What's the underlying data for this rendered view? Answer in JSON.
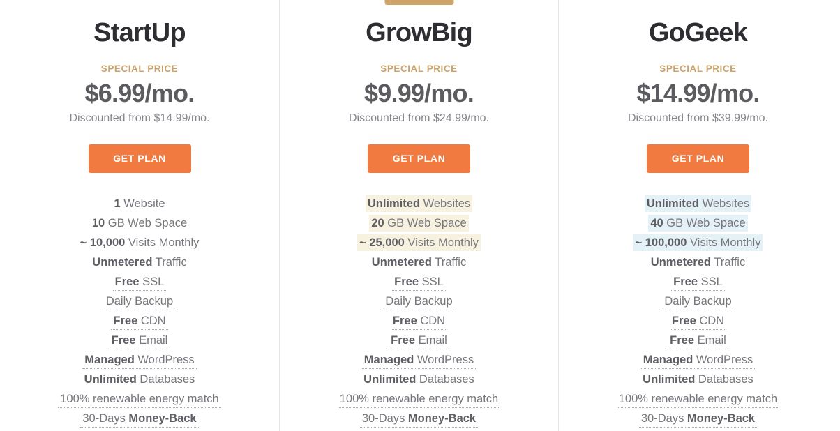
{
  "plans": [
    {
      "id": "startup",
      "name": "StartUp",
      "special_price_label": "SPECIAL PRICE",
      "price": "$6.99/mo.",
      "discount_note": "Discounted from $14.99/mo.",
      "cta_label": "GET PLAN",
      "recommended": false,
      "recommended_label": "",
      "highlight_color": "",
      "features": [
        {
          "strong": "1",
          "rest": " Website",
          "tip": false,
          "highlight": false
        },
        {
          "strong": "10",
          "rest": " GB Web Space",
          "tip": false,
          "highlight": false
        },
        {
          "strong": "~ 10,000",
          "rest": " Visits Monthly",
          "tip": false,
          "highlight": false
        },
        {
          "strong": "Unmetered",
          "rest": " Traffic",
          "tip": false,
          "highlight": false
        },
        {
          "strong": "Free",
          "rest": " SSL",
          "tip": true,
          "highlight": false
        },
        {
          "strong": "",
          "rest": "Daily Backup",
          "tip": true,
          "highlight": false
        },
        {
          "strong": "Free",
          "rest": " CDN",
          "tip": true,
          "highlight": false
        },
        {
          "strong": "Free",
          "rest": " Email",
          "tip": true,
          "highlight": false
        },
        {
          "strong": "Managed",
          "rest": " WordPress",
          "tip": true,
          "highlight": false
        },
        {
          "strong": "Unlimited",
          "rest": " Databases",
          "tip": false,
          "highlight": false
        },
        {
          "strong": "",
          "rest": "100% renewable energy match",
          "tip": true,
          "highlight": false
        },
        {
          "strong": "",
          "rest": "30-Days ",
          "strong_after": "Money-Back",
          "tip": true,
          "highlight": false
        }
      ]
    },
    {
      "id": "growbig",
      "name": "GrowBig",
      "special_price_label": "SPECIAL PRICE",
      "price": "$9.99/mo.",
      "discount_note": "Discounted from $24.99/mo.",
      "cta_label": "GET PLAN",
      "recommended": true,
      "recommended_label": "",
      "highlight_color": "#f7f2df",
      "features": [
        {
          "strong": "Unlimited",
          "rest": " Websites",
          "tip": false,
          "highlight": true
        },
        {
          "strong": "20",
          "rest": " GB Web Space",
          "tip": false,
          "highlight": true
        },
        {
          "strong": "~ 25,000",
          "rest": " Visits Monthly",
          "tip": false,
          "highlight": true
        },
        {
          "strong": "Unmetered",
          "rest": " Traffic",
          "tip": false,
          "highlight": false
        },
        {
          "strong": "Free",
          "rest": " SSL",
          "tip": true,
          "highlight": false
        },
        {
          "strong": "",
          "rest": "Daily Backup",
          "tip": true,
          "highlight": false
        },
        {
          "strong": "Free",
          "rest": " CDN",
          "tip": true,
          "highlight": false
        },
        {
          "strong": "Free",
          "rest": " Email",
          "tip": true,
          "highlight": false
        },
        {
          "strong": "Managed",
          "rest": " WordPress",
          "tip": true,
          "highlight": false
        },
        {
          "strong": "Unlimited",
          "rest": " Databases",
          "tip": false,
          "highlight": false
        },
        {
          "strong": "",
          "rest": "100% renewable energy match",
          "tip": true,
          "highlight": false
        },
        {
          "strong": "",
          "rest": "30-Days ",
          "strong_after": "Money-Back",
          "tip": true,
          "highlight": false
        }
      ]
    },
    {
      "id": "gogeek",
      "name": "GoGeek",
      "special_price_label": "SPECIAL PRICE",
      "price": "$14.99/mo.",
      "discount_note": "Discounted from $39.99/mo.",
      "cta_label": "GET PLAN",
      "recommended": false,
      "recommended_label": "",
      "highlight_color": "#e4f1f7",
      "features": [
        {
          "strong": "Unlimited",
          "rest": " Websites",
          "tip": false,
          "highlight": true
        },
        {
          "strong": "40",
          "rest": " GB Web Space",
          "tip": false,
          "highlight": true
        },
        {
          "strong": "~ 100,000",
          "rest": " Visits Monthly",
          "tip": false,
          "highlight": true
        },
        {
          "strong": "Unmetered",
          "rest": " Traffic",
          "tip": false,
          "highlight": false
        },
        {
          "strong": "Free",
          "rest": " SSL",
          "tip": true,
          "highlight": false
        },
        {
          "strong": "",
          "rest": "Daily Backup",
          "tip": true,
          "highlight": false
        },
        {
          "strong": "Free",
          "rest": " CDN",
          "tip": true,
          "highlight": false
        },
        {
          "strong": "Free",
          "rest": " Email",
          "tip": true,
          "highlight": false
        },
        {
          "strong": "Managed",
          "rest": " WordPress",
          "tip": true,
          "highlight": false
        },
        {
          "strong": "Unlimited",
          "rest": " Databases",
          "tip": false,
          "highlight": false
        },
        {
          "strong": "",
          "rest": "100% renewable energy match",
          "tip": true,
          "highlight": false
        },
        {
          "strong": "",
          "rest": "30-Days ",
          "strong_after": "Money-Back",
          "tip": true,
          "highlight": false
        }
      ]
    }
  ],
  "theme": {
    "cta_color": "#f17a40",
    "accent_gold": "#cba36a",
    "title_color": "#2d2d32",
    "price_color": "#5b5b60",
    "feature_color": "#76767c",
    "divider_color": "#e6e6e8",
    "recommend_tab_color": "#cfa469"
  }
}
